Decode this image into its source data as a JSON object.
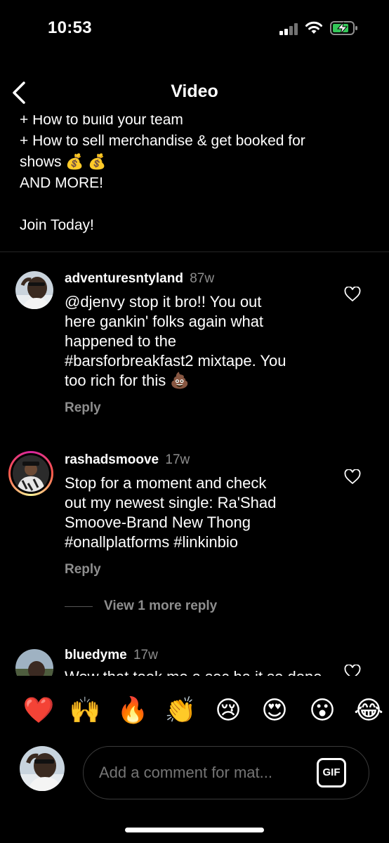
{
  "status_bar": {
    "time": "10:53"
  },
  "nav": {
    "title": "Video"
  },
  "caption": {
    "lines": [
      "+ How to build your team",
      "+ How to sell merchandise & get booked for",
      "shows 💰 💰",
      "AND MORE!",
      "",
      "Join Today!"
    ]
  },
  "comments": [
    {
      "username": "adventuresntyland",
      "time": "87w",
      "text_lines": [
        "@djenvy stop it bro!! You out",
        "here gankin' folks again what",
        "happened to the",
        "#barsforbreakfast2 mixtape. You",
        "too rich for this 💩"
      ],
      "reply_label": "Reply"
    },
    {
      "username": "rashadsmoove",
      "time": "17w",
      "text_lines": [
        "Stop for a moment and check",
        "out my newest single: Ra'Shad",
        "Smoove-Brand New Thong",
        "#onallplatforms #linkinbio"
      ],
      "reply_label": "Reply",
      "view_more_label": "View 1 more reply"
    },
    {
      "username": "bluedyme",
      "time": "17w",
      "text_lines": [
        "Wow that took me a sec ha it so dope"
      ]
    }
  ],
  "emoji_bar": [
    "❤️",
    "🙌",
    "🔥",
    "👏",
    "😢",
    "😍",
    "😮",
    "😂"
  ],
  "composer": {
    "placeholder": "Add a comment for mat...",
    "gif_label": "GIF"
  },
  "colors": {
    "background": "#000000",
    "muted": "#8e8e8e",
    "divider": "#262626"
  }
}
